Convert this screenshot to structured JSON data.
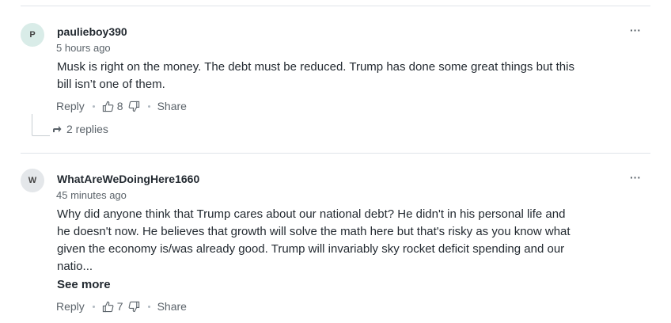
{
  "comments": [
    {
      "avatar_letter": "P",
      "avatar_color": "#d9ece8",
      "username": "paulieboy390",
      "timestamp": "5 hours ago",
      "body_line1": "Musk is right on the money. The debt must be reduced. Trump has done some great things but this",
      "body_line2": "bill isn’t one of them.",
      "reply_label": "Reply",
      "likes": "8",
      "share_label": "Share",
      "more_label": "···",
      "replies_label": "2 replies"
    },
    {
      "avatar_letter": "W",
      "avatar_color": "#e4e7ea",
      "username": "WhatAreWeDoingHere1660",
      "timestamp": "45 minutes ago",
      "body_line1": "Why did anyone think that Trump cares about our national debt? He didn't in his personal life and",
      "body_line2": "he doesn't now. He believes that growth will solve the math here but that's risky as you know what",
      "body_line3": "given the economy is/was already good. Trump will invariably sky rocket deficit spending and our",
      "body_line4": "natio...",
      "see_more_label": "See more",
      "reply_label": "Reply",
      "likes": "7",
      "share_label": "Share",
      "more_label": "···"
    }
  ]
}
